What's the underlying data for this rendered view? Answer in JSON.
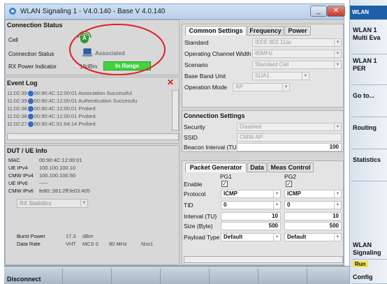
{
  "window": {
    "title": "WLAN Signaling 1 - V4.0.140 - Base V 4.0.140",
    "minimize_glyph": "_",
    "close_glyph": "✕"
  },
  "connection_status": {
    "title": "Connection Status",
    "cell_label": "Cell",
    "cell_icon_letter": "A",
    "status_label": "Connection Status",
    "status_value": "Associated",
    "rx_label": "RX Power Indicator",
    "rx_value": "18dBm",
    "rx_badge": "In Range"
  },
  "event_log": {
    "title": "Event Log",
    "entries": [
      {
        "time": "11:02:39",
        "text": "00:90:4C:12:00:01 Association Successful"
      },
      {
        "time": "11:02:39",
        "text": "00:90:4C:12:00:01 Authentication Successfu"
      },
      {
        "time": "11:02:38",
        "text": "00:90:4C:12:00:01 Probed"
      },
      {
        "time": "11:02:38",
        "text": "00:90:4C:12:00:01 Probed"
      },
      {
        "time": "11:02:27",
        "text": "00:90:4C:51:64:14 Probed"
      }
    ]
  },
  "dut_info": {
    "title": "DUT / UE Info",
    "rows": [
      {
        "label": "MAC",
        "value": "00:90:4C:12:00:01"
      },
      {
        "label": "UE IPv4",
        "value": "100.100.100.10"
      },
      {
        "label": "CMW IPv4",
        "value": "100.100.100.50"
      },
      {
        "label": "UE IPv6",
        "value": "-----"
      },
      {
        "label": "CMW IPv6",
        "value": "fe80::281:2ff:fe03:405"
      }
    ],
    "rx_stats_select": "RX Statistics",
    "burst_power_label": "Burst Power",
    "burst_power_value": "17.3",
    "burst_power_unit": "dBm",
    "data_rate_label": "Data Rate",
    "data_rate_values": [
      "VHT",
      "MCS 0",
      "80 MHz",
      "Nss1"
    ]
  },
  "common_settings": {
    "tabs": [
      "Common Settings",
      "Frequency",
      "Power"
    ],
    "rows": [
      {
        "label": "Standard",
        "value": "IEEE 802.11ac"
      },
      {
        "label": "Operating Channel Width",
        "value": "80MHz"
      },
      {
        "label": "Scenario",
        "value": "Standard Cell"
      },
      {
        "label": "Base Band Unit",
        "value": "SUA1"
      },
      {
        "label": "Operation Mode",
        "value": "AP"
      }
    ]
  },
  "connection_settings": {
    "title": "Connection Settings",
    "security_label": "Security",
    "security_value": "Disabled",
    "ssid_label": "SSID",
    "ssid_value": "CMW-AP",
    "beacon_label": "Beacon Interval (TU)",
    "beacon_value": "100"
  },
  "packet_generator": {
    "tabs": [
      "Packet Generator",
      "Data",
      "Meas Control"
    ],
    "pg1": "PG1",
    "pg2": "PG2",
    "enable_label": "Enable",
    "check_glyph": "✓",
    "protocol_label": "Protocol",
    "protocol_pg1": "ICMP",
    "protocol_pg2": "ICMP",
    "tid_label": "TID",
    "tid_pg1": "0",
    "tid_pg2": "0",
    "interval_label": "Interval (TU)",
    "interval_pg1": "10",
    "interval_pg2": "10",
    "size_label": "Size (Byte)",
    "size_pg1": "500",
    "size_pg2": "500",
    "payload_label": "Payload Type",
    "payload_pg1": "Default",
    "payload_pg2": "Default"
  },
  "sidebar": {
    "top_label": "WLAN",
    "items": [
      {
        "label": "WLAN 1 Multi Eva"
      },
      {
        "label": "WLAN 1 PER"
      },
      {
        "label": "Go to..."
      },
      {
        "label": "Routing"
      },
      {
        "label": "Statistics"
      },
      {
        "label": "WLAN Signaling"
      },
      {
        "label": "Config"
      }
    ],
    "run_label": "Run"
  },
  "bottom": {
    "disconnect_label": "Disconnect"
  }
}
